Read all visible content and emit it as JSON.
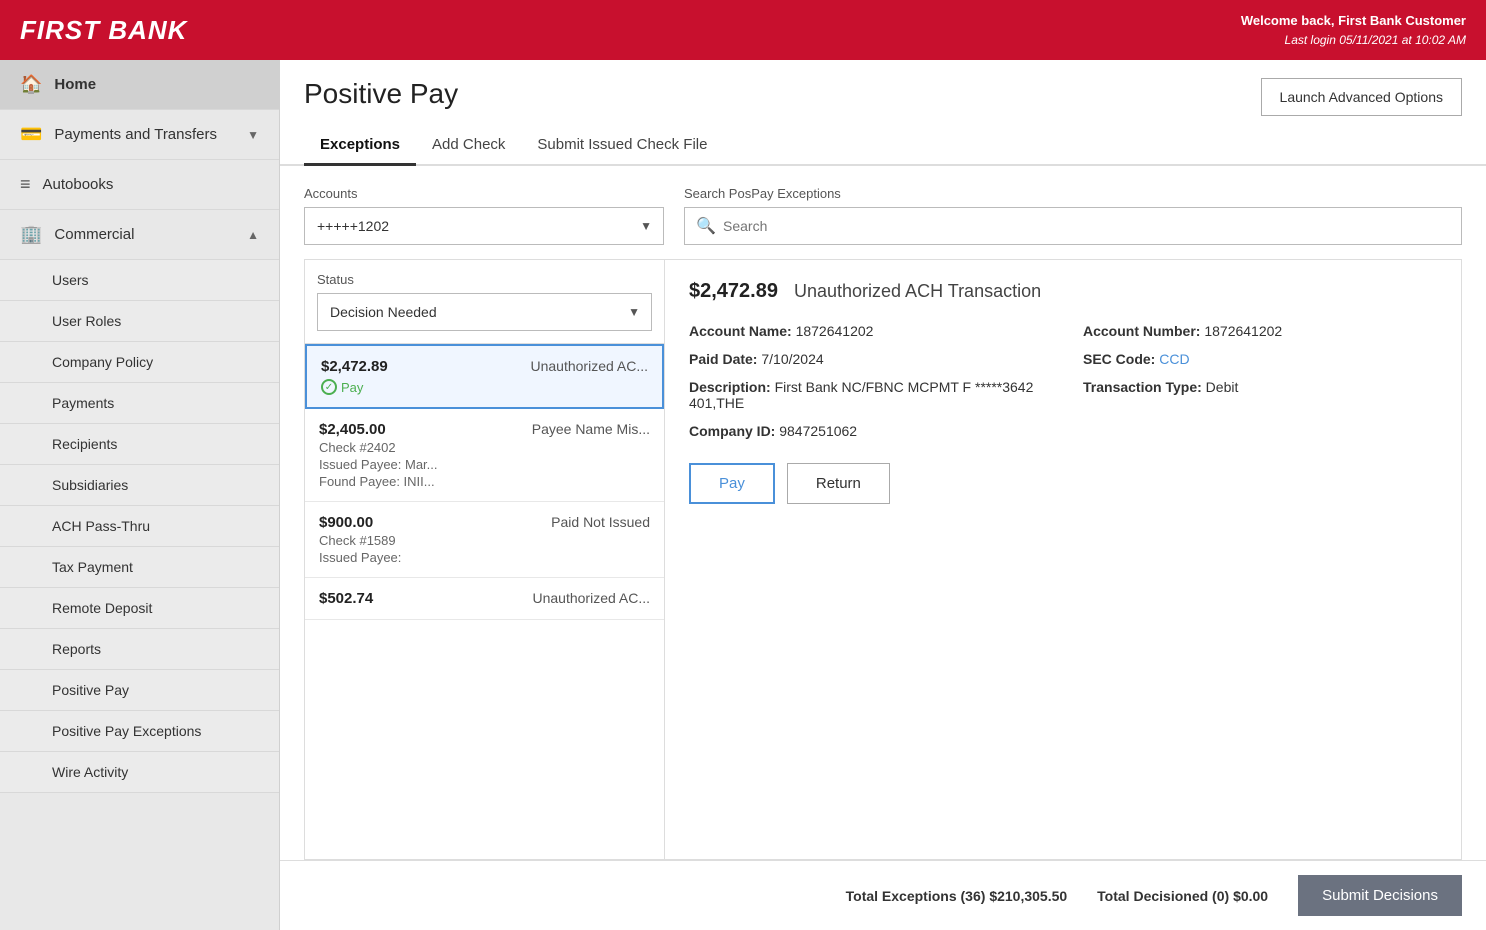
{
  "brand": "FIRST BANK",
  "header": {
    "welcome": "Welcome back, First Bank Customer",
    "last_login": "Last login 05/11/2021 at 10:02 AM"
  },
  "sidebar": {
    "items": [
      {
        "id": "home",
        "label": "Home",
        "icon": "🏠",
        "active": true
      },
      {
        "id": "payments",
        "label": "Payments and Transfers",
        "icon": "💳",
        "has_chevron": true
      },
      {
        "id": "autobooks",
        "label": "Autobooks",
        "icon": "≡"
      },
      {
        "id": "commercial",
        "label": "Commercial",
        "icon": "🏢",
        "expanded": true,
        "has_chevron": true
      }
    ],
    "sub_items": [
      {
        "label": "Users"
      },
      {
        "label": "User Roles"
      },
      {
        "label": "Company Policy"
      },
      {
        "label": "Payments"
      },
      {
        "label": "Recipients"
      },
      {
        "label": "Subsidiaries"
      },
      {
        "label": "ACH Pass-Thru"
      },
      {
        "label": "Tax Payment"
      },
      {
        "label": "Remote Deposit"
      },
      {
        "label": "Reports"
      },
      {
        "label": "Positive Pay"
      },
      {
        "label": "Positive Pay Exceptions"
      },
      {
        "label": "Wire Activity"
      }
    ]
  },
  "page": {
    "title": "Positive Pay",
    "launch_btn": "Launch Advanced Options"
  },
  "tabs": [
    {
      "label": "Exceptions",
      "active": true
    },
    {
      "label": "Add Check"
    },
    {
      "label": "Submit Issued Check File"
    }
  ],
  "accounts_label": "Accounts",
  "accounts_value": "+++++1202",
  "search_label": "Search PosPay Exceptions",
  "search_placeholder": "Search",
  "status_label": "Status",
  "status_value": "Decision Needed",
  "exceptions": [
    {
      "amount": "$2,472.89",
      "type": "Unauthorized AC...",
      "badge": "Pay",
      "selected": true
    },
    {
      "amount": "$2,405.00",
      "sub1": "Check #2402",
      "type": "Payee Name Mis...",
      "sub2": "Issued Payee: Mar...",
      "sub3": "Found Payee: INII...",
      "selected": false
    },
    {
      "amount": "$900.00",
      "sub1": "Check #1589",
      "type": "Paid Not Issued",
      "sub2": "Issued Payee:",
      "selected": false
    },
    {
      "amount": "$502.74",
      "type": "Unauthorized AC...",
      "selected": false
    }
  ],
  "detail": {
    "amount": "$2,472.89",
    "type": "Unauthorized ACH Transaction",
    "fields": [
      {
        "label": "Account Name:",
        "value": "1872641202",
        "col": 1
      },
      {
        "label": "Account Number:",
        "value": "1872641202",
        "col": 2
      },
      {
        "label": "Paid Date:",
        "value": "7/10/2024",
        "col": 1
      },
      {
        "label": "SEC Code:",
        "value": "CCD",
        "col": 2,
        "link": true
      },
      {
        "label": "Description:",
        "value": "First Bank NC/FBNC MCPMT F *****3642 401,THE",
        "col": 1
      },
      {
        "label": "Transaction Type:",
        "value": "Debit",
        "col": 2
      },
      {
        "label": "Company ID:",
        "value": "9847251062",
        "col": 1
      }
    ],
    "pay_btn": "Pay",
    "return_btn": "Return"
  },
  "footer": {
    "total_exceptions_label": "Total Exceptions",
    "total_exceptions_count": "(36)",
    "total_exceptions_amount": "$210,305.50",
    "total_decisioned_label": "Total Decisioned",
    "total_decisioned_count": "(0)",
    "total_decisioned_amount": "$0.00",
    "submit_btn": "Submit Decisions"
  }
}
